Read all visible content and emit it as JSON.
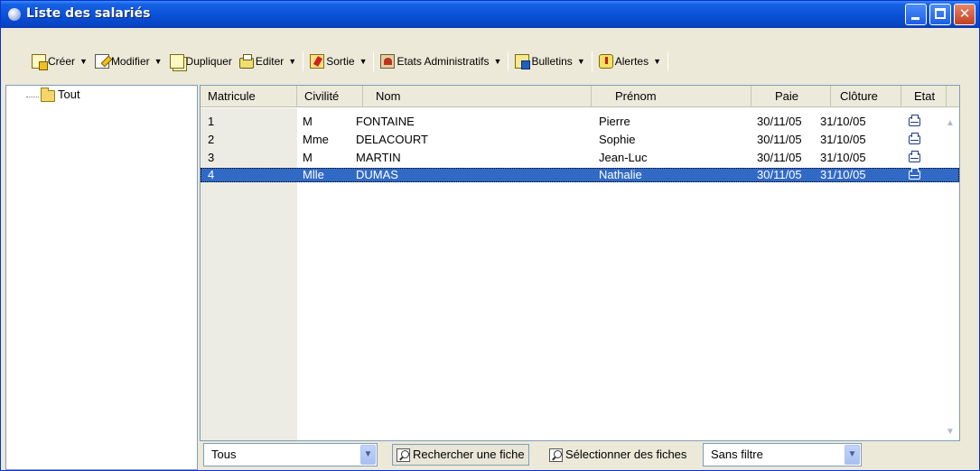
{
  "window": {
    "title": "Liste des salariés"
  },
  "toolbar": {
    "create": "Créer",
    "modify": "Modifier",
    "duplicate": "Dupliquer",
    "edit": "Editer",
    "output": "Sortie",
    "admin_states": "Etats Administratifs",
    "payslips": "Bulletins",
    "alerts": "Alertes"
  },
  "tree": {
    "root_label": "Tout"
  },
  "grid": {
    "columns": [
      "Matricule",
      "Civilité",
      "Nom",
      "Prénom",
      "Paie",
      "Clôture",
      "Etat"
    ],
    "rows": [
      {
        "matricule": "1",
        "civilite": "M",
        "nom": "FONTAINE",
        "prenom": "Pierre",
        "paie": "30/11/05",
        "cloture": "31/10/05",
        "etat": "printer-icon"
      },
      {
        "matricule": "2",
        "civilite": "Mme",
        "nom": "DELACOURT",
        "prenom": "Sophie",
        "paie": "30/11/05",
        "cloture": "31/10/05",
        "etat": "printer-icon"
      },
      {
        "matricule": "3",
        "civilite": "M",
        "nom": "MARTIN",
        "prenom": "Jean-Luc",
        "paie": "30/11/05",
        "cloture": "31/10/05",
        "etat": "printer-icon"
      },
      {
        "matricule": "4",
        "civilite": "Mlle",
        "nom": "DUMAS",
        "prenom": "Nathalie",
        "paie": "30/11/05",
        "cloture": "31/10/05",
        "etat": "printer-icon",
        "selected": true
      }
    ]
  },
  "bottom": {
    "scope_select": "Tous",
    "search_button": "Rechercher une fiche",
    "select_button": "Sélectionner des fiches",
    "filter_select": "Sans filtre"
  },
  "colors": {
    "titlebar": "#0a53d9",
    "selection": "#316ac5",
    "chrome": "#ece9d8"
  }
}
